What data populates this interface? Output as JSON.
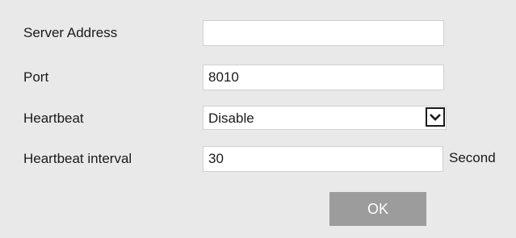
{
  "form": {
    "server_address": {
      "label": "Server Address",
      "value": ""
    },
    "port": {
      "label": "Port",
      "value": "8010"
    },
    "heartbeat": {
      "label": "Heartbeat",
      "selected": "Disable"
    },
    "heartbeat_interval": {
      "label": "Heartbeat interval",
      "value": "30",
      "unit": "Second"
    },
    "ok_label": "OK"
  },
  "colors": {
    "background": "#e9e9e9",
    "field_background": "#ffffff",
    "button_background": "#9c9c9c",
    "button_text": "#ffffff",
    "text": "#1a1a1a"
  }
}
